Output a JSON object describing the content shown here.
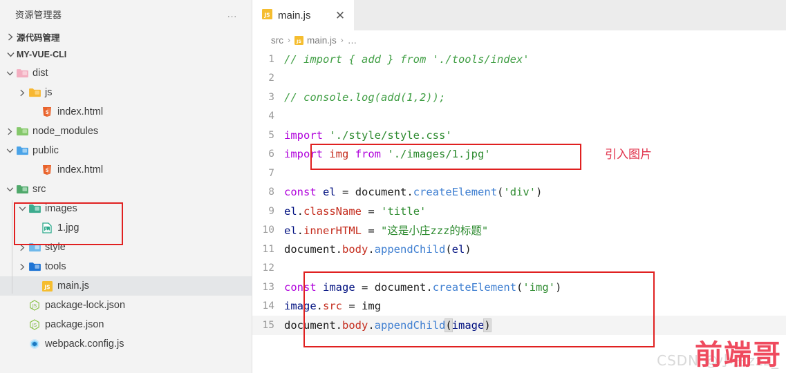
{
  "sidebar": {
    "title": "资源管理器",
    "more_label": "…",
    "sections": [
      {
        "label": "源代码管理",
        "expanded": false
      },
      {
        "label": "MY-VUE-CLI",
        "expanded": true
      }
    ],
    "tree": [
      {
        "label": "dist",
        "icon": "folder-pink-icon",
        "twisty": "chevron-down",
        "indent": 0,
        "selected": false
      },
      {
        "label": "js",
        "icon": "folder-orange-icon",
        "twisty": "chevron-right",
        "indent": 1,
        "selected": false
      },
      {
        "label": "index.html",
        "icon": "html5-icon",
        "twisty": "none",
        "indent": 2,
        "selected": false
      },
      {
        "label": "node_modules",
        "icon": "folder-green-icon",
        "twisty": "chevron-right",
        "indent": 0,
        "selected": false
      },
      {
        "label": "public",
        "icon": "folder-blue-icon",
        "twisty": "chevron-down",
        "indent": 0,
        "selected": false
      },
      {
        "label": "index.html",
        "icon": "html5-icon",
        "twisty": "none",
        "indent": 2,
        "selected": false
      },
      {
        "label": "src",
        "icon": "folder-src-icon",
        "twisty": "chevron-down",
        "indent": 0,
        "selected": false
      },
      {
        "label": "images",
        "icon": "folder-images-icon",
        "twisty": "chevron-down",
        "indent": 1,
        "selected": false
      },
      {
        "label": "1.jpg",
        "icon": "image-file-icon",
        "twisty": "none",
        "indent": 2,
        "selected": false
      },
      {
        "label": "style",
        "icon": "folder-style-icon",
        "twisty": "chevron-right",
        "indent": 1,
        "selected": false
      },
      {
        "label": "tools",
        "icon": "folder-tools-icon",
        "twisty": "chevron-right",
        "indent": 1,
        "selected": false
      },
      {
        "label": "main.js",
        "icon": "js-icon",
        "twisty": "none",
        "indent": 2,
        "selected": true
      },
      {
        "label": "package-lock.json",
        "icon": "nodejs-icon",
        "twisty": "none",
        "indent": 1,
        "selected": false
      },
      {
        "label": "package.json",
        "icon": "nodejs-icon",
        "twisty": "none",
        "indent": 1,
        "selected": false
      },
      {
        "label": "webpack.config.js",
        "icon": "webpack-icon",
        "twisty": "none",
        "indent": 1,
        "selected": false
      }
    ],
    "highlight_box": {
      "target": "images-folder-and-1jpg",
      "color": "#e02020"
    }
  },
  "editor": {
    "tabs": [
      {
        "label": "main.js",
        "icon": "js-icon",
        "close_label": "✕",
        "active": true
      }
    ],
    "breadcrumb": {
      "items": [
        "src",
        "main.js",
        "…"
      ],
      "separator": "›"
    },
    "lines": [
      {
        "num": "1",
        "text": "// import { add } from './tools/index'"
      },
      {
        "num": "2",
        "text": ""
      },
      {
        "num": "3",
        "text": "// console.log(add(1,2));"
      },
      {
        "num": "4",
        "text": ""
      },
      {
        "num": "5",
        "text": "import './style/style.css'"
      },
      {
        "num": "6",
        "text": "import img from './images/1.jpg'"
      },
      {
        "num": "7",
        "text": ""
      },
      {
        "num": "8",
        "text": "const el = document.createElement('div')"
      },
      {
        "num": "9",
        "text": "el.className = 'title'"
      },
      {
        "num": "10",
        "text": "el.innerHTML = \"这是小庄zzz的标题\""
      },
      {
        "num": "11",
        "text": "document.body.appendChild(el)"
      },
      {
        "num": "12",
        "text": ""
      },
      {
        "num": "13",
        "text": "const image = document.createElement('img')"
      },
      {
        "num": "14",
        "text": "image.src = img"
      },
      {
        "num": "15",
        "text": "document.body.appendChild(image)",
        "active": true
      }
    ],
    "annotation": "引入图片",
    "highlight_boxes": [
      {
        "target": "line-6-import-image",
        "color": "#e02020"
      },
      {
        "target": "lines-13-to-15-create-img",
        "color": "#e02020"
      }
    ]
  },
  "watermark": {
    "main": "前端哥",
    "sub": "CSDN @小庄zzz_"
  },
  "colors": {
    "accent_red": "#e02020",
    "keyword": "#af00db",
    "string": "#2e8b30",
    "comment": "#43a047",
    "property": "#c42b1c",
    "function": "#3f7fd1",
    "variable": "#001080",
    "sidebar_bg": "#f3f3f3",
    "tabbar_bg": "#ececec"
  }
}
